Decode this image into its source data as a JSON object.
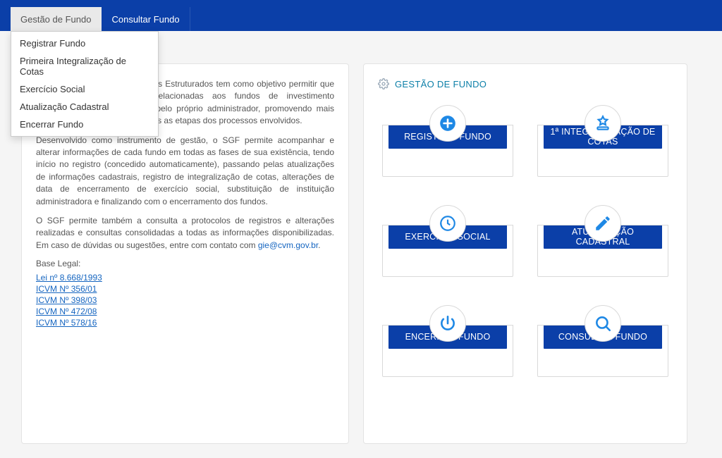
{
  "nav": {
    "items": [
      "Gestão de Fundo",
      "Consultar Fundo"
    ]
  },
  "dropdown": {
    "items": [
      "Registrar Fundo",
      "Primeira Integralização de Cotas",
      "Exercício Social",
      "Atualização Cadastral",
      "Encerrar Fundo"
    ]
  },
  "intro": {
    "p1_a": "O Sistema de Gestão de Fundos Estruturados tem como objetivo permitir que as informações cadastrais relacionadas aos fundos de investimento estruturados sejam prestadas pelo próprio administrador, promovendo mais rapidez e transparência em todas as etapas dos processos envolvidos.",
    "p2": "Desenvolvido como instrumento de gestão, o SGF permite acompanhar e alterar informações de cada fundo em todas as fases de sua existência, tendo início no registro (concedido automaticamente), passando pelas atualizações de informações cadastrais, registro de integralização de cotas, alterações de data de encerramento de exercício social, substituição de instituição administradora e finalizando com o encerramento dos fundos.",
    "p3_a": "O SGF permite também a consulta a protocolos de registros e alterações realizadas e consultas consolidadas a todas as informações disponibilizadas. Em caso de dúvidas ou sugestões, entre com contato com ",
    "p3_link": "gie@cvm.gov.br",
    "p3_b": ".",
    "base_legal_label": "Base Legal:",
    "legal_links": [
      "Lei nº 8.668/1993",
      "ICVM Nº 356/01",
      "ICVM Nº 398/03",
      "ICVM Nº 472/08",
      "ICVM Nº 578/16"
    ]
  },
  "actions": {
    "section_title": "GESTÃO DE FUNDO",
    "tiles": [
      {
        "label": "REGISTRAR FUNDO"
      },
      {
        "label": "1ª INTEGRALIZAÇÃO DE COTAS"
      },
      {
        "label": "EXERCÍCIO SOCIAL"
      },
      {
        "label": "ATUALIZAÇÃO CADASTRAL"
      },
      {
        "label": "ENCERRAR FUNDO"
      },
      {
        "label": "CONSULTAR FUNDO"
      }
    ]
  }
}
